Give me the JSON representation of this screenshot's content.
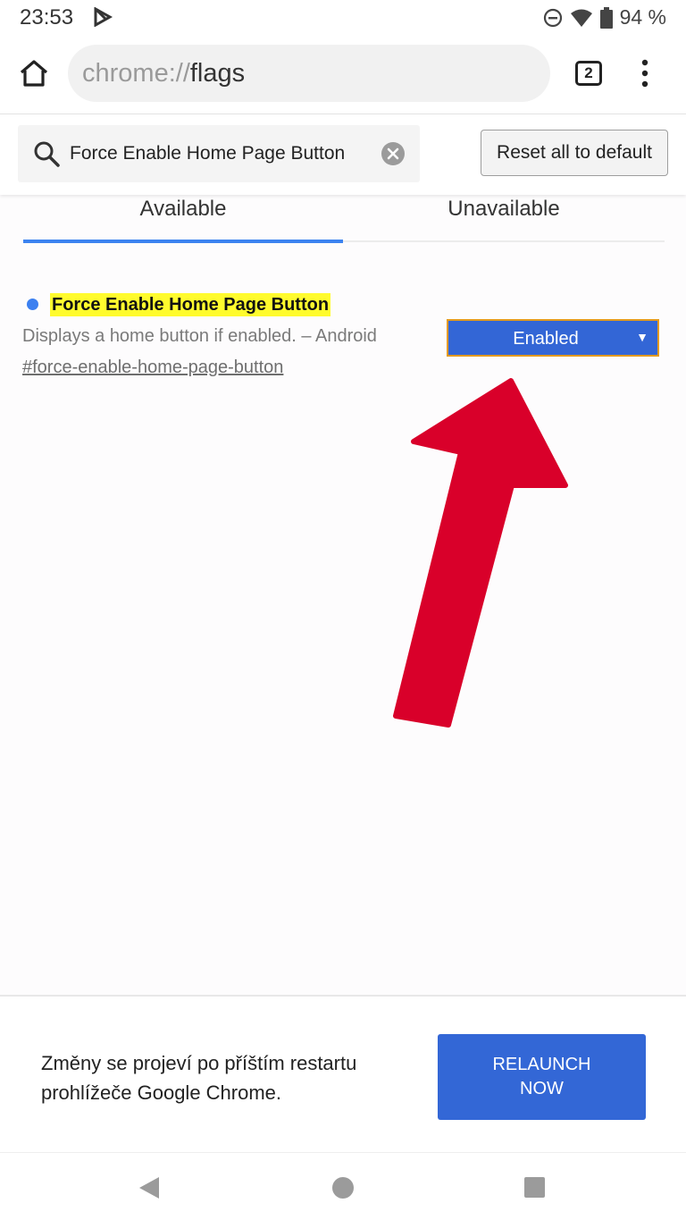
{
  "status_bar": {
    "time": "23:53",
    "battery_text": "94 %",
    "icons": [
      "play-store-notification-icon",
      "do-not-disturb-icon",
      "wifi-icon",
      "battery-icon"
    ]
  },
  "toolbar": {
    "url_scheme": "chrome://",
    "url_host": "flags",
    "tab_count": "2",
    "icons": [
      "home-icon",
      "tab-switcher-icon",
      "more-vert-icon"
    ]
  },
  "search": {
    "query": "Force Enable Home Page Button",
    "reset_label": "Reset all to default",
    "icons": [
      "search-icon",
      "clear-icon"
    ]
  },
  "tabs": {
    "available": "Available",
    "unavailable": "Unavailable",
    "active": "Available"
  },
  "flag": {
    "title": "Force Enable Home Page Button",
    "description": "Displays a home button if enabled. – Android",
    "link": "#force-enable-home-page-button",
    "selected_value": "Enabled",
    "highlight_color": "#fffb2d",
    "select_color": "#3366d6"
  },
  "relaunch": {
    "message_line1": "Změny se projeví po příštím restartu",
    "message_line2": "prohlížeče Google Chrome.",
    "button_line1": "RELAUNCH",
    "button_line2": "NOW",
    "button_color": "#3367d6"
  },
  "annotation": {
    "arrow_color": "#d9002a"
  },
  "nav_bar": {
    "icons": [
      "back-icon",
      "home-nav-icon",
      "recents-icon"
    ]
  }
}
